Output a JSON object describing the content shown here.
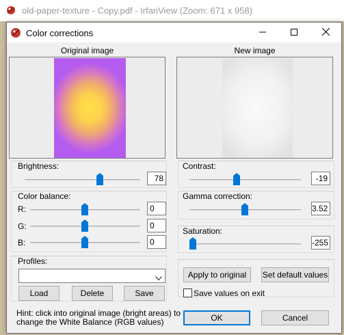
{
  "app_window": {
    "title": "old-paper-texture - Copy.pdf - IrfanView (Zoom: 671 x 958)"
  },
  "dialog": {
    "title": "Color corrections",
    "controls": {
      "minimize": "minimize",
      "maximize": "maximize",
      "close": "close"
    }
  },
  "preview": {
    "original_label": "Original image",
    "new_label": "New image"
  },
  "brightness": {
    "label": "Brightness:",
    "value": "78",
    "slider_fraction": 0.7
  },
  "color_balance": {
    "label": "Color balance:",
    "r_label": "R:",
    "r_value": "0",
    "r_fraction": 0.5,
    "g_label": "G:",
    "g_value": "0",
    "g_fraction": 0.5,
    "b_label": "B:",
    "b_value": "0",
    "b_fraction": 0.5
  },
  "contrast": {
    "label": "Contrast:",
    "value": "-19",
    "slider_fraction": 0.45
  },
  "gamma": {
    "label": "Gamma correction:",
    "value": "3.52",
    "slider_fraction": 0.5
  },
  "saturation": {
    "label": "Saturation:",
    "value": "-255",
    "slider_fraction": 0.0
  },
  "profiles": {
    "label": "Profiles:",
    "selected": "",
    "load_label": "Load",
    "delete_label": "Delete",
    "save_label": "Save"
  },
  "actions": {
    "apply_label": "Apply to original",
    "defaults_label": "Set default values",
    "save_on_exit_label": "Save values on exit",
    "save_on_exit_checked": false,
    "ok_label": "OK",
    "cancel_label": "Cancel"
  },
  "hint": {
    "line1": "Hint: click into original image (bright areas) to",
    "line2": "change the White Balance (RGB values)"
  },
  "colors": {
    "accent": "#0078d7",
    "slider_thumb": "#0078d7"
  },
  "icons": {
    "app": "irfanview-red-icon",
    "dialog": "irfanview-red-icon",
    "dropdown": "chevron-down-icon"
  }
}
